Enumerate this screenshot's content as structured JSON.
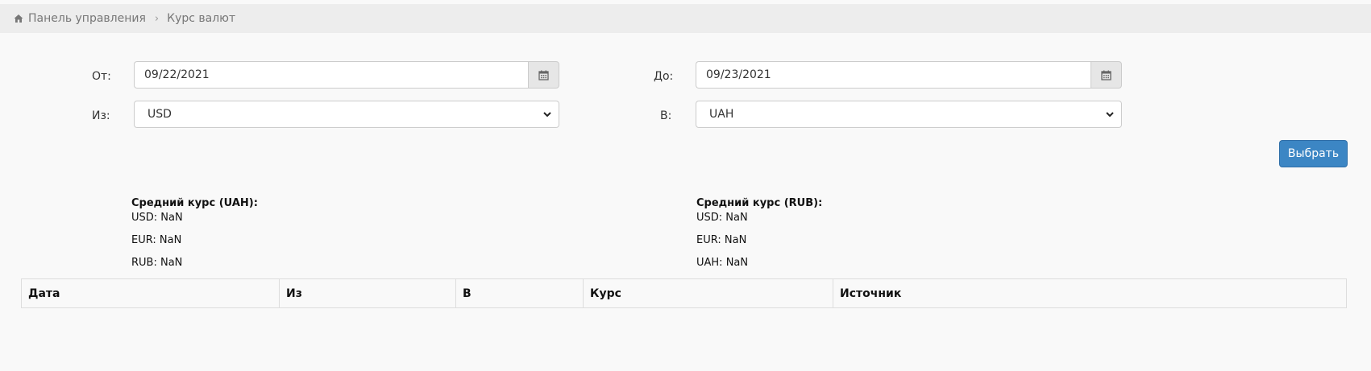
{
  "breadcrumb": {
    "home_label": "Панель управления",
    "current_label": "Курс валют"
  },
  "filters": {
    "from_date_label": "От:",
    "from_date_value": "09/22/2021",
    "to_date_label": "До:",
    "to_date_value": "09/23/2021",
    "from_currency_label": "Из:",
    "from_currency_value": "USD",
    "to_currency_label": "В:",
    "to_currency_value": "UAH",
    "submit_label": "Выбрать"
  },
  "averages": {
    "left": {
      "title": "Средний курс (UAH):",
      "lines": [
        "USD: NaN",
        "EUR: NaN",
        "RUB: NaN"
      ]
    },
    "right": {
      "title": "Средний курс (RUB):",
      "lines": [
        "USD: NaN",
        "EUR: NaN",
        "UAH: NaN"
      ]
    }
  },
  "table": {
    "columns": [
      "Дата",
      "Из",
      "В",
      "Курс",
      "Источник"
    ]
  },
  "icons": {
    "home": "home-icon",
    "calendar": "calendar-icon",
    "chevron": "chevron-down-icon"
  },
  "colors": {
    "primary": "#3c86c4",
    "breadcrumb_bg": "#ededed",
    "page_bg": "#f9f9f9"
  }
}
